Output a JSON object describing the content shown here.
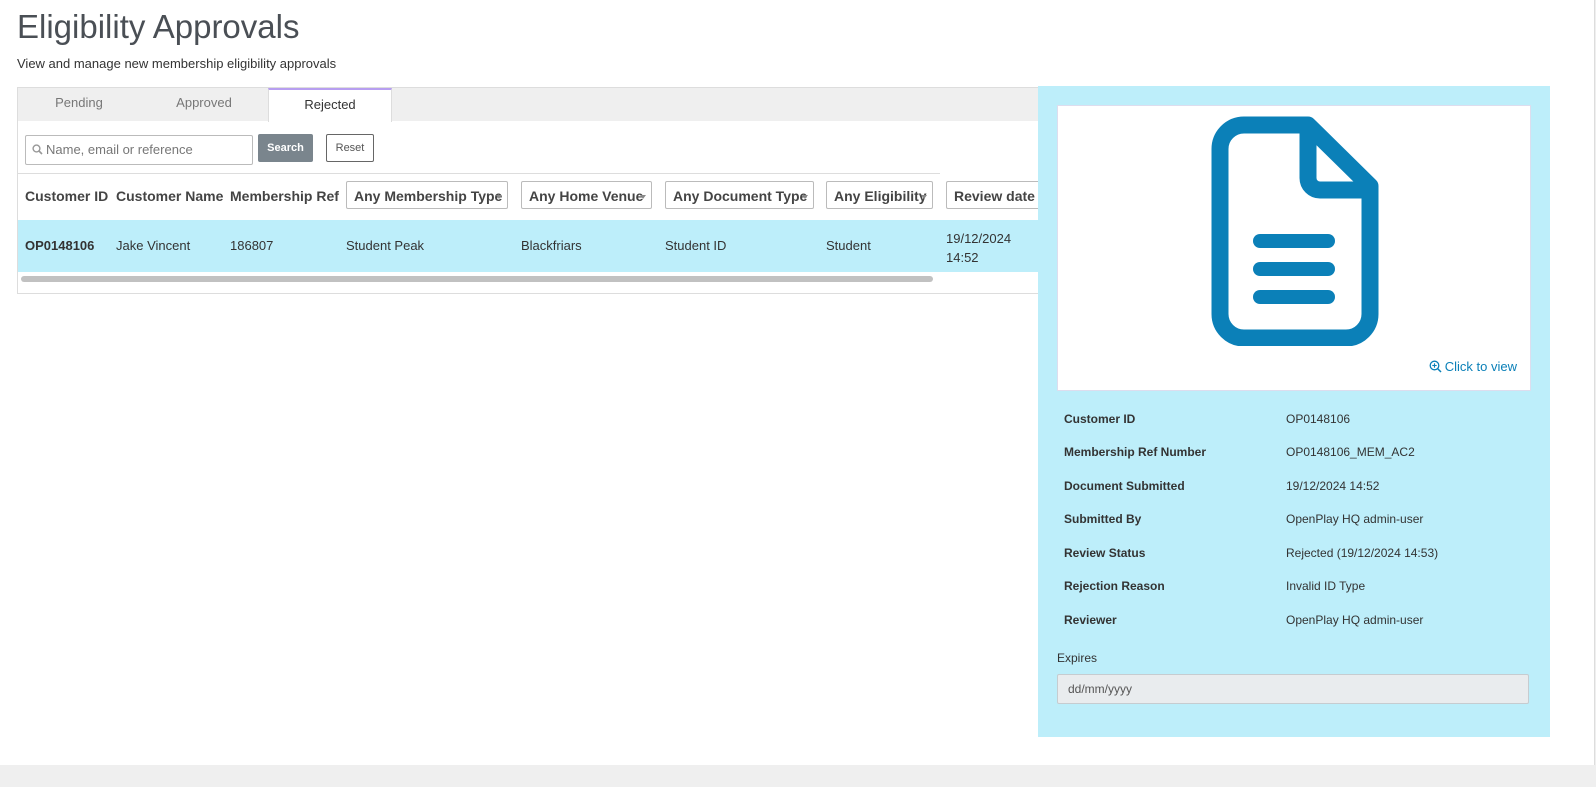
{
  "page": {
    "title": "Eligibility Approvals",
    "subtitle": "View and manage new membership eligibility approvals"
  },
  "tabs": [
    {
      "label": "Pending"
    },
    {
      "label": "Approved"
    },
    {
      "label": "Rejected",
      "active": true
    }
  ],
  "search": {
    "placeholder": "Name, email or reference",
    "value": "",
    "search_label": "Search",
    "reset_label": "Reset"
  },
  "table": {
    "columns": {
      "customer_id": "Customer ID",
      "customer_name": "Customer Name",
      "membership_ref": "Membership Ref"
    },
    "filters": {
      "membership_type": "Any Membership Type",
      "home_venue": "Any Home Venue",
      "document_type": "Any Document Type",
      "eligibility": "Any Eligibility",
      "review_date": "Review date"
    },
    "rows": [
      {
        "customer_id": "OP0148106",
        "customer_name": "Jake Vincent",
        "membership_ref": "186807",
        "membership_type": "Student Peak",
        "home_venue": "Blackfriars",
        "document_type": "Student ID",
        "eligibility": "Student",
        "review_date": "19/12/2024",
        "review_time": "14:52"
      }
    ]
  },
  "detail": {
    "preview_link": "Click to view",
    "fields": [
      {
        "label": "Customer ID",
        "value": "OP0148106"
      },
      {
        "label": "Membership Ref Number",
        "value": "OP0148106_MEM_AC2"
      },
      {
        "label": "Document Submitted",
        "value": "19/12/2024 14:52"
      },
      {
        "label": "Submitted By",
        "value": "OpenPlay HQ admin-user"
      },
      {
        "label": "Review Status",
        "value": "Rejected (19/12/2024 14:53)"
      },
      {
        "label": "Rejection Reason",
        "value": "Invalid ID Type"
      },
      {
        "label": "Reviewer",
        "value": "OpenPlay HQ admin-user"
      }
    ],
    "expires_label": "Expires",
    "expires_placeholder": "dd/mm/yyyy"
  },
  "colors": {
    "accent": "#0b80b8",
    "selected_row": "#bdeefa",
    "active_tab_border": "#b79ef0",
    "search_button": "#7a858d"
  },
  "icons": [
    "search-icon",
    "document-icon",
    "zoom-in-icon",
    "caret-down-icon"
  ]
}
